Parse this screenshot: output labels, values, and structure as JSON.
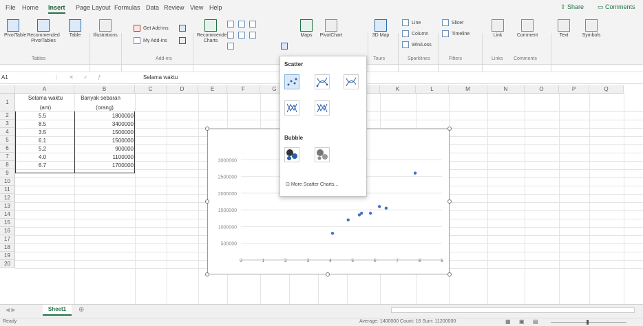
{
  "menubar": {
    "tabs": [
      "File",
      "Home",
      "Insert",
      "Page Layout",
      "Formulas",
      "Data",
      "Review",
      "View",
      "Help"
    ],
    "active": "Insert",
    "share": "Share",
    "comments": "Comments"
  },
  "ribbon": {
    "pivot": "PivotTable",
    "recommended_pivot": "Recommended PivotTables",
    "table": "Table",
    "illustrations": "Illustrations",
    "add_ins": "Get Add-ins",
    "my_add_ins": "My Add-ins",
    "recommended_charts": "Recommended Charts",
    "maps": "Maps",
    "pivotchart": "PivotChart",
    "map3d": "3D Map",
    "line": "Line",
    "column": "Column",
    "winloss": "Win/Loss",
    "slicer": "Slicer",
    "timeline": "Timeline",
    "link": "Link",
    "comment": "Comment",
    "text": "Text",
    "symbols": "Symbols",
    "groups": {
      "tables": "Tables",
      "addins": "Add-ins",
      "tours": "Tours",
      "sparklines": "Sparklines",
      "filters": "Filters",
      "links": "Links",
      "comments": "Comments"
    }
  },
  "formula_bar": {
    "name_box": "A1",
    "formula": "Selama waktu"
  },
  "columns": [
    "A",
    "B",
    "C",
    "D",
    "E",
    "F",
    "G",
    "H",
    "I",
    "J",
    "K",
    "L",
    "M",
    "N",
    "O",
    "P",
    "Q"
  ],
  "rows": [
    "1",
    "2",
    "3",
    "4",
    "5",
    "6",
    "7",
    "8",
    "9",
    "10",
    "11",
    "12",
    "13",
    "14",
    "15",
    "16",
    "17",
    "18",
    "19",
    "20"
  ],
  "table": {
    "header_a1": "Selama waktu",
    "header_a2": "(am)",
    "header_b1": "Banyak sebaran",
    "header_b2": "(orang)",
    "a": [
      "5.5",
      "8.5",
      "3.5",
      "6.1",
      "5.2",
      "4.0",
      "6.7"
    ],
    "b": [
      "1800000",
      "3400000",
      "1500000",
      "1500000",
      "900000",
      "1100000",
      "1700000"
    ]
  },
  "chart_data": {
    "type": "scatter",
    "x": [
      5.4,
      5.3,
      6.5,
      6.2,
      5.8,
      4.8,
      4.1,
      7.8
    ],
    "y": [
      1400000,
      1350000,
      1550000,
      1600000,
      1400000,
      1200000,
      800000,
      2600000
    ],
    "xlim": [
      0,
      9
    ],
    "ylim": [
      0,
      3500000
    ],
    "ytick_labels": [
      "500000",
      "1000000",
      "1500000",
      "2000000",
      "2500000",
      "3000000"
    ],
    "xtick_labels": [
      "0",
      "1",
      "2",
      "3",
      "4",
      "5",
      "6",
      "7",
      "8",
      "9"
    ],
    "marker_color": "#4472c4"
  },
  "dropdown": {
    "scatter_title": "Scatter",
    "bubble_title": "Bubble",
    "more": "More Scatter Charts..."
  },
  "sheet": {
    "tab": "Sheet1"
  },
  "status": {
    "left": "Ready",
    "right": "Average: 1400000   Count: 16   Sum: 11200000"
  }
}
